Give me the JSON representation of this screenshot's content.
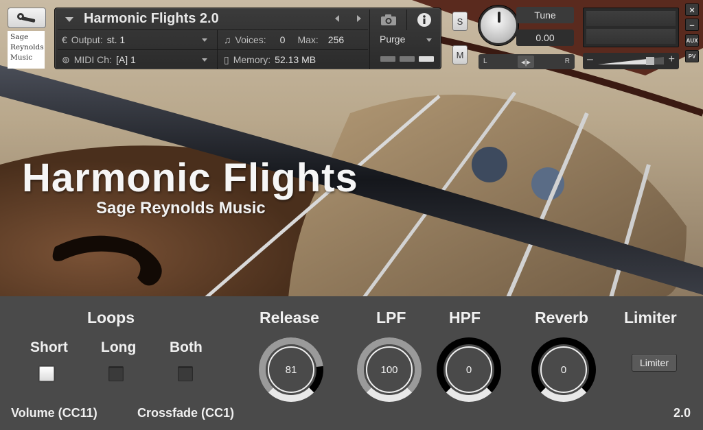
{
  "header": {
    "logo_lines": [
      "Sage",
      "Reynolds",
      "Music"
    ],
    "instrument_name": "Harmonic Flights 2.0",
    "output_label": "Output:",
    "output_value": "st. 1",
    "voices_label": "Voices:",
    "voices_value": "0",
    "max_label": "Max:",
    "max_value": "256",
    "midi_label": "MIDI Ch:",
    "midi_value": "[A]  1",
    "memory_label": "Memory:",
    "memory_value": "52.13 MB",
    "purge_label": "Purge",
    "solo_label": "S",
    "mute_label": "M",
    "tune_label": "Tune",
    "tune_value": "0.00",
    "pan_left": "L",
    "pan_right": "R",
    "aux_label": "AUX",
    "pv_label": "PV",
    "minimize_label": "–",
    "close_label": "×",
    "vol_minus": "–",
    "vol_plus": "+"
  },
  "artwork": {
    "title": "Harmonic Flights",
    "subtitle": "Sage Reynolds Music"
  },
  "panel": {
    "loops_heading": "Loops",
    "loops_options": [
      {
        "label": "Short",
        "checked": true
      },
      {
        "label": "Long",
        "checked": false
      },
      {
        "label": "Both",
        "checked": false
      }
    ],
    "knobs": [
      {
        "heading": "Release",
        "value": "81",
        "level": 0.81
      },
      {
        "heading": "LPF",
        "value": "100",
        "level": 1.0
      },
      {
        "heading": "HPF",
        "value": "0",
        "level": 0.0
      },
      {
        "heading": "Reverb",
        "value": "0",
        "level": 0.0
      }
    ],
    "limiter_heading": "Limiter",
    "limiter_button": "Limiter",
    "volume_label": "Volume (CC11)",
    "crossfade_label": "Crossfade (CC1)",
    "version": "2.0"
  },
  "colors": {
    "panel_bg": "#4a4a4a",
    "knob_track": "#000000",
    "knob_fill": "#9a9a9a",
    "text": "#f0f0f0"
  }
}
